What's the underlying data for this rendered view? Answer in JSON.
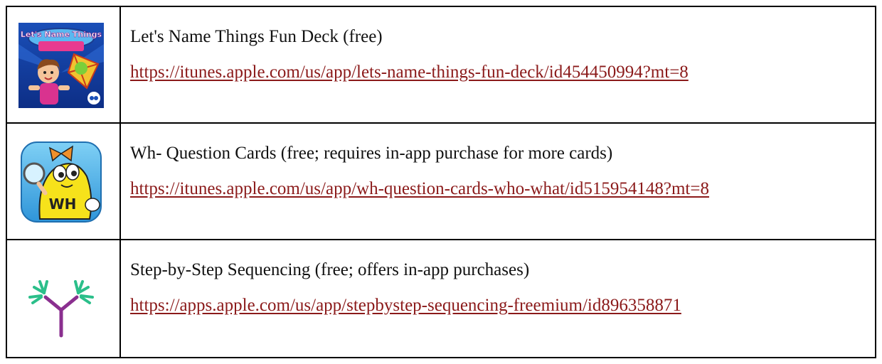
{
  "rows": [
    {
      "icon": "lets-name-things-app-icon",
      "title": "Let's Name Things Fun Deck (free)",
      "link": "https://itunes.apple.com/us/app/lets-name-things-fun-deck/id454450994?mt=8",
      "icon_text": "Let's Name Things"
    },
    {
      "icon": "wh-question-cards-app-icon",
      "title": "Wh- Question Cards (free; requires in-app purchase for more cards)",
      "link": "https://itunes.apple.com/us/app/wh-question-cards-who-what/id515954148?mt=8",
      "icon_text": "WH"
    },
    {
      "icon": "step-by-step-sequencing-app-icon",
      "title": "Step-by-Step Sequencing (free; offers in-app purchases)",
      "link": "https://apps.apple.com/us/app/stepbystep-sequencing-freemium/id896358871"
    }
  ],
  "colors": {
    "link": "#8b1a1a",
    "border": "#000000",
    "sequencing_purple": "#8a2f8f",
    "sequencing_green": "#2bbf8a"
  }
}
